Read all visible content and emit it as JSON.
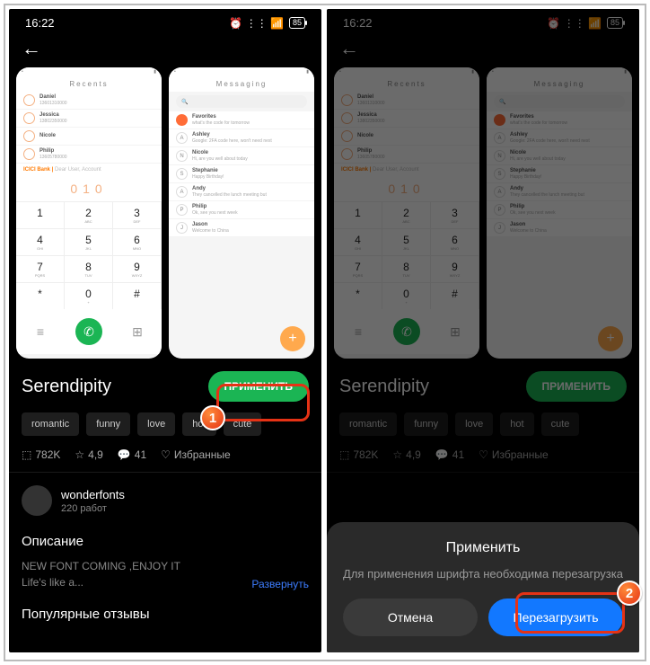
{
  "status": {
    "time": "16:22",
    "battery": "85"
  },
  "previews": {
    "left_title": "Recents",
    "right_title": "Messaging",
    "dial_number": "010",
    "contacts": [
      {
        "name": "Daniel",
        "sub": "13601310000"
      },
      {
        "name": "Jessica",
        "sub": "13802350000"
      },
      {
        "name": "Nicole",
        "sub": ""
      },
      {
        "name": "Philip",
        "sub": "13605780000"
      }
    ],
    "bank": "ICICI Bank |",
    "bank_sub": "Dear User, Account",
    "messages": [
      {
        "avatar": "orange",
        "name": "Favorites",
        "sub": "what's the code for tomorrow"
      },
      {
        "avatar": "A",
        "name": "Ashley",
        "sub": "Google: 2FA code here, won't need next"
      },
      {
        "avatar": "N",
        "name": "Nicole",
        "sub": "Hi, are you well about today"
      },
      {
        "avatar": "S",
        "name": "Stephanie",
        "sub": "Happy Birthday!"
      },
      {
        "avatar": "A",
        "name": "Andy",
        "sub": "They cancelled the lunch meeting but"
      },
      {
        "avatar": "P",
        "name": "Philip",
        "sub": "Ok, see you next week"
      },
      {
        "avatar": "J",
        "name": "Jason",
        "sub": "Welcome to China"
      }
    ],
    "keypad": [
      [
        "1",
        ""
      ],
      [
        "2",
        "ABC"
      ],
      [
        "3",
        "DEF"
      ],
      [
        "4",
        "GHI"
      ],
      [
        "5",
        "JKL"
      ],
      [
        "6",
        "MNO"
      ],
      [
        "7",
        "PQRS"
      ],
      [
        "8",
        "TUV"
      ],
      [
        "9",
        "WXYZ"
      ],
      [
        "*",
        ""
      ],
      [
        "0",
        "+"
      ],
      [
        "#",
        ""
      ]
    ]
  },
  "theme": {
    "title": "Serendipity",
    "apply": "ПРИМЕНИТЬ",
    "tags": [
      "romantic",
      "funny",
      "love",
      "hot",
      "cute"
    ],
    "stats": {
      "downloads": "782K",
      "rating": "4,9",
      "comments": "41",
      "fav": "Избранные"
    }
  },
  "author": {
    "name": "wonderfonts",
    "sub": "220 работ"
  },
  "description": {
    "heading": "Описание",
    "line1": "NEW FONT COMING ,ENJOY IT",
    "line2": "Life's like a...",
    "expand": "Развернуть"
  },
  "reviews_heading": "Популярные отзывы",
  "dialog": {
    "title": "Применить",
    "message": "Для применения шрифта необходима перезагрузка",
    "cancel": "Отмена",
    "reboot": "Перезагрузить"
  },
  "markers": {
    "one": "1",
    "two": "2"
  }
}
